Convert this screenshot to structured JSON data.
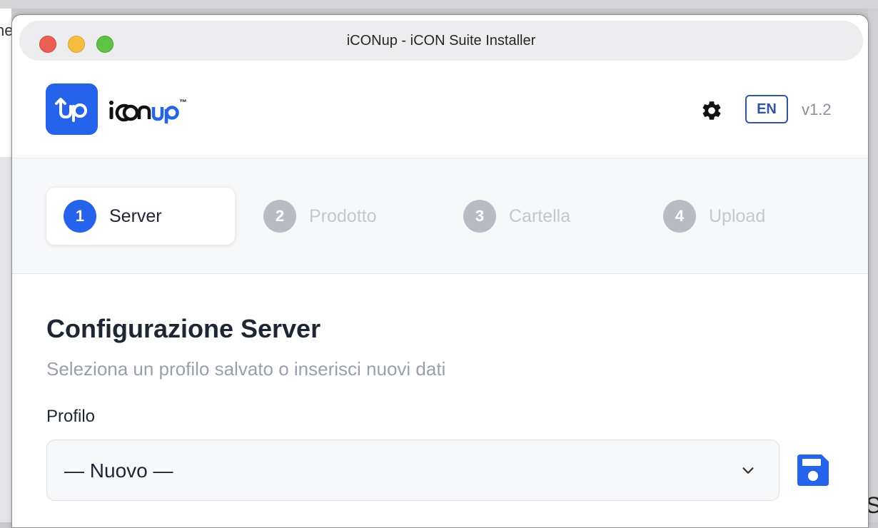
{
  "window": {
    "title": "iCONup - iCON Suite Installer"
  },
  "background": {
    "left_text": "ne",
    "right_text": "S"
  },
  "header": {
    "brand_name": "iCONup",
    "trademark": "™",
    "language": "EN",
    "version": "v1.2",
    "icons": [
      "app-logo-icon",
      "gear-icon"
    ]
  },
  "stepper": {
    "steps": [
      {
        "number": "1",
        "label": "Server",
        "active": true
      },
      {
        "number": "2",
        "label": "Prodotto",
        "active": false
      },
      {
        "number": "3",
        "label": "Cartella",
        "active": false
      },
      {
        "number": "4",
        "label": "Upload",
        "active": false
      }
    ]
  },
  "main": {
    "title": "Configurazione Server",
    "subtitle": "Seleziona un profilo salvato o inserisci nuovi dati",
    "profile_label": "Profilo",
    "profile_value": "— Nuovo —",
    "icons": [
      "chevron-down-icon",
      "save-icon"
    ]
  },
  "colors": {
    "accent": "#2563eb",
    "lang_border": "#2f55a3",
    "step_inactive": "#b7bcc4",
    "muted_text": "#9aa0a9"
  }
}
